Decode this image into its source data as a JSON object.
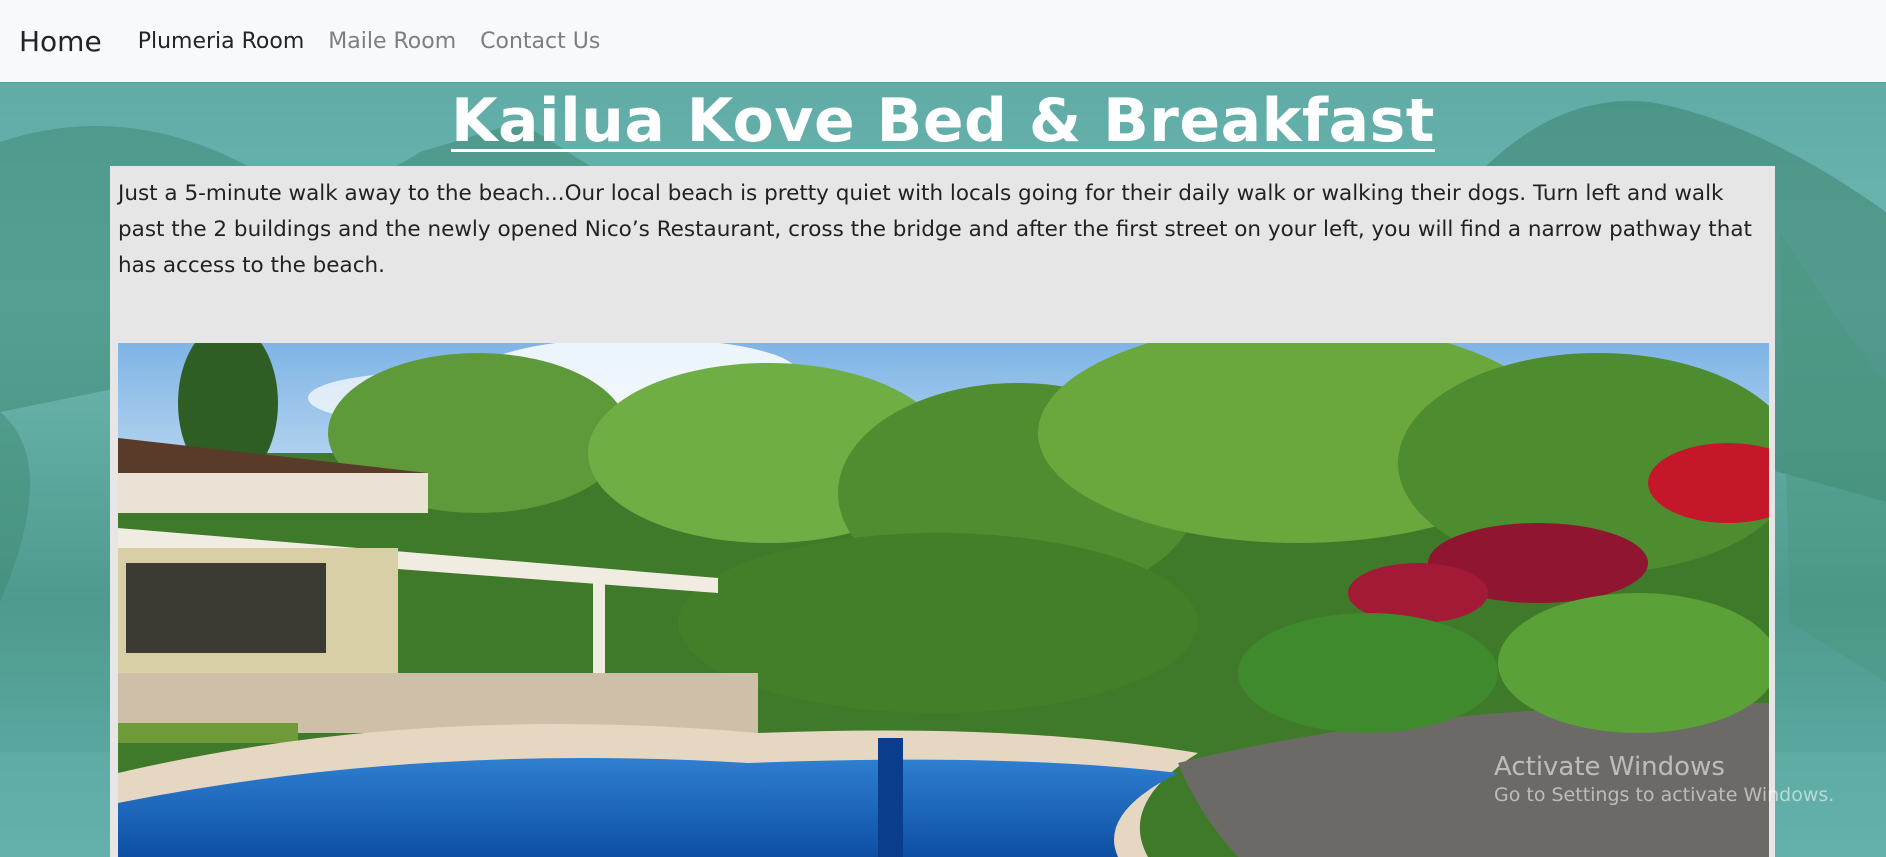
{
  "navbar": {
    "brand": "Home",
    "links": [
      "Plumeria Room",
      "Maile Room",
      "Contact Us"
    ]
  },
  "hero": {
    "title": "Kailua Kove Bed & Breakfast"
  },
  "content": {
    "intro": "Just a 5-minute walk away to the beach...Our local beach is pretty quiet with locals going for their daily walk or walking their dogs. Turn left and walk past the 2 buildings and the newly opened Nico’s Restaurant, cross the bridge and after the first street on your left, you will find a narrow pathway that has access to the beach."
  },
  "watermark": {
    "line1": "Activate Windows",
    "line2": "Go to Settings to activate Windows."
  },
  "colors": {
    "navbar_bg": "#f8f9fa",
    "card_bg": "#e6e6e6",
    "background_teal": "#6fb9b3",
    "title_color": "#ffffff"
  }
}
